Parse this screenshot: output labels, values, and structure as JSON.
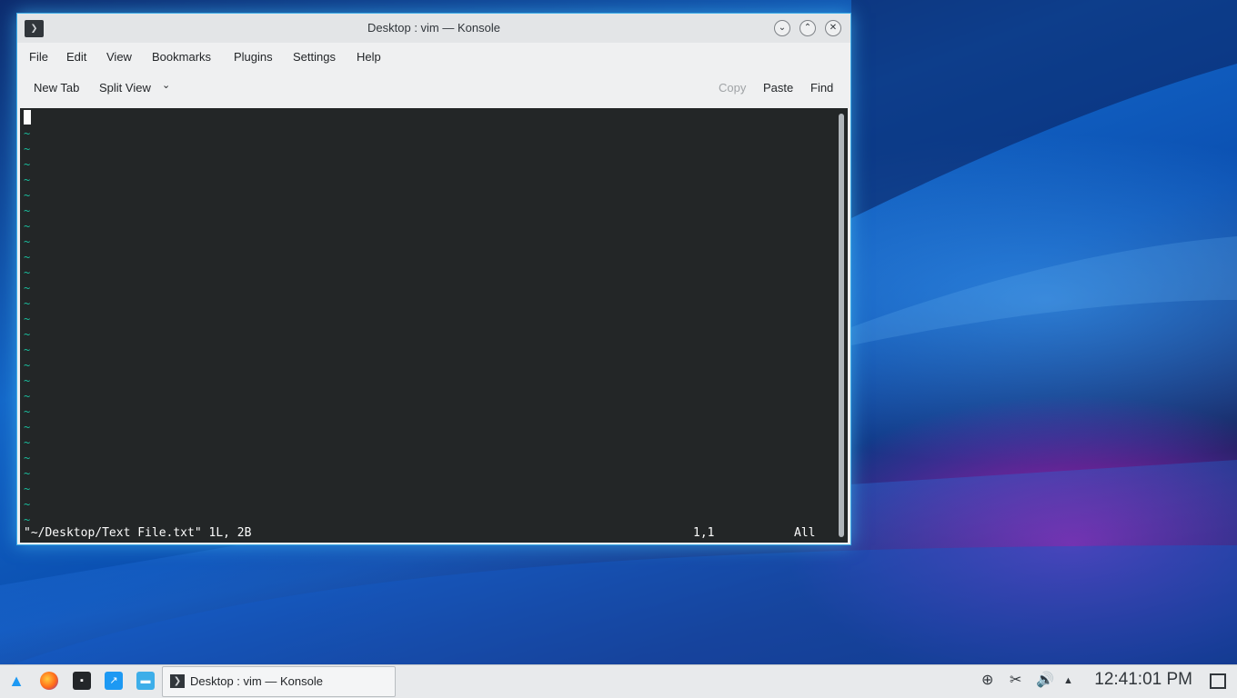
{
  "window": {
    "title": "Desktop : vim — Konsole",
    "app_icon_glyph": "❯",
    "controls": {
      "minimize": "⌄",
      "maximize": "⌃",
      "close": "✕"
    }
  },
  "menu": [
    "File",
    "Edit",
    "View",
    "Bookmarks",
    "Plugins",
    "Settings",
    "Help"
  ],
  "toolbar": {
    "new_tab": "New Tab",
    "split_view": "Split View",
    "split_chevron": "⌄",
    "copy": "Copy",
    "paste": "Paste",
    "find": "Find"
  },
  "terminal": {
    "tilde": "~",
    "tilde_count": 26,
    "status_file": "\"~/Desktop/Text File.txt\" 1L, 2B",
    "status_pos": "1,1",
    "status_scroll": "All"
  },
  "taskbar": {
    "task_label": "Desktop : vim — Konsole",
    "task_icon_glyph": "❯",
    "launchers": [
      {
        "icon": "app-launcher-icon"
      },
      {
        "icon": "firefox-icon"
      },
      {
        "icon": "system-monitor-icon"
      },
      {
        "icon": "discover-icon"
      },
      {
        "icon": "file-manager-icon"
      }
    ],
    "tray": {
      "network": "⊕",
      "clipboard": "✂",
      "volume": "🔊",
      "expand": "▲"
    },
    "clock": "12:41:01 PM"
  },
  "colors": {
    "accent": "#3daee9",
    "terminal_bg": "#232627",
    "tilde": "#1abc9c"
  }
}
